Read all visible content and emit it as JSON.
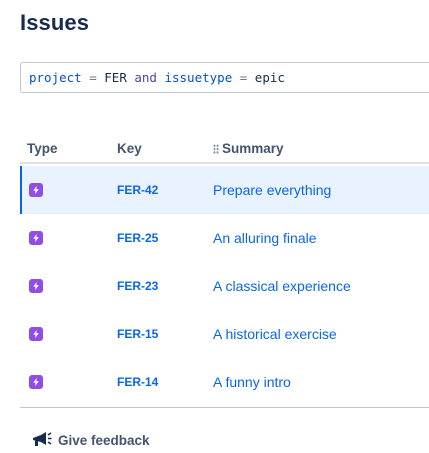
{
  "page": {
    "title": "Issues"
  },
  "search": {
    "tokens": [
      {
        "text": "project",
        "kind": "field"
      },
      {
        "text": " = ",
        "kind": "op"
      },
      {
        "text": "FER",
        "kind": "val"
      },
      {
        "text": " and ",
        "kind": "kw"
      },
      {
        "text": "issuetype",
        "kind": "field"
      },
      {
        "text": " = ",
        "kind": "op"
      },
      {
        "text": "epic",
        "kind": "val"
      }
    ]
  },
  "table": {
    "columns": {
      "type": "Type",
      "key": "Key",
      "summary": "Summary"
    },
    "rows": [
      {
        "type_icon": "lightning-epic-icon",
        "key": "FER-42",
        "summary": "Prepare everything",
        "selected": true
      },
      {
        "type_icon": "lightning-epic-icon",
        "key": "FER-25",
        "summary": "An alluring finale",
        "selected": false
      },
      {
        "type_icon": "lightning-epic-icon",
        "key": "FER-23",
        "summary": "A classical experience",
        "selected": false
      },
      {
        "type_icon": "lightning-epic-icon",
        "key": "FER-15",
        "summary": "A historical exercise",
        "selected": false
      },
      {
        "type_icon": "lightning-epic-icon",
        "key": "FER-14",
        "summary": "A funny intro",
        "selected": false
      }
    ]
  },
  "footer": {
    "feedback_label": "Give feedback",
    "feedback_icon": "megaphone-icon"
  },
  "colors": {
    "epic_purple": "#904ee2",
    "link_blue": "#0c66e4",
    "selected_row_bg": "#e9f2ff"
  }
}
